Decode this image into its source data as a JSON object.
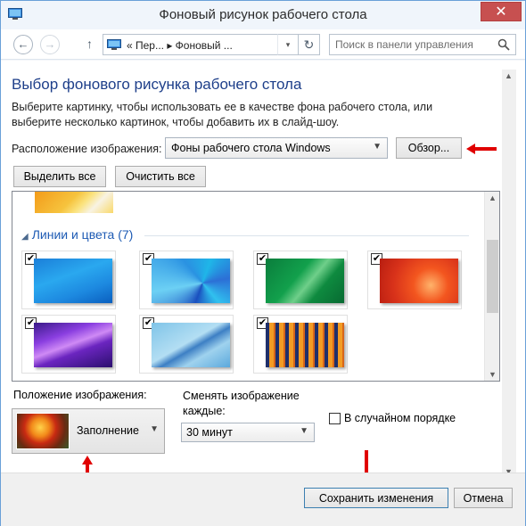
{
  "window": {
    "title": "Фоновый рисунок рабочего стола",
    "close_glyph": "✕"
  },
  "nav": {
    "back_glyph": "←",
    "forward_glyph": "→",
    "up_glyph": "↑",
    "address": "«  Пер...  ▸  Фоновый ...",
    "address_dropdown": "▾",
    "refresh_glyph": "↻",
    "search_placeholder": "Поиск в панели управления"
  },
  "main": {
    "heading": "Выбор фонового рисунка рабочего стола",
    "description": "Выберите картинку, чтобы использовать ее в качестве фона рабочего стола, или выберите несколько картинок, чтобы добавить их в слайд-шоу.",
    "location_label": "Расположение изображения:",
    "location_value": "Фоны рабочего стола Windows",
    "browse_label": "Обзор...",
    "select_all_label": "Выделить все",
    "clear_all_label": "Очистить все"
  },
  "gallery": {
    "group_title": "Линии и цвета (7)",
    "group_toggle": "◢",
    "check_glyph": "✔",
    "items": [
      {
        "name": "blue-lines",
        "checked": true
      },
      {
        "name": "blue-kaleidoscope",
        "checked": true
      },
      {
        "name": "green-ribbon",
        "checked": true
      },
      {
        "name": "red-orange-swirl",
        "checked": true
      },
      {
        "name": "purple-waves",
        "checked": true
      },
      {
        "name": "sky-blue-curves",
        "checked": true
      },
      {
        "name": "orange-stripes",
        "checked": true
      }
    ]
  },
  "options": {
    "position_label": "Положение изображения:",
    "position_value": "Заполнение",
    "change_label": "Сменять изображение каждые:",
    "interval_value": "30 минут",
    "shuffle_label": "В случайном порядке",
    "shuffle_checked": false
  },
  "footer": {
    "save_label": "Сохранить изменения",
    "cancel_label": "Отмена"
  },
  "colors": {
    "heading": "#1e3f8a",
    "group_title": "#1e5bb4",
    "annotation_arrow": "#e00000",
    "close_button": "#c75050"
  }
}
